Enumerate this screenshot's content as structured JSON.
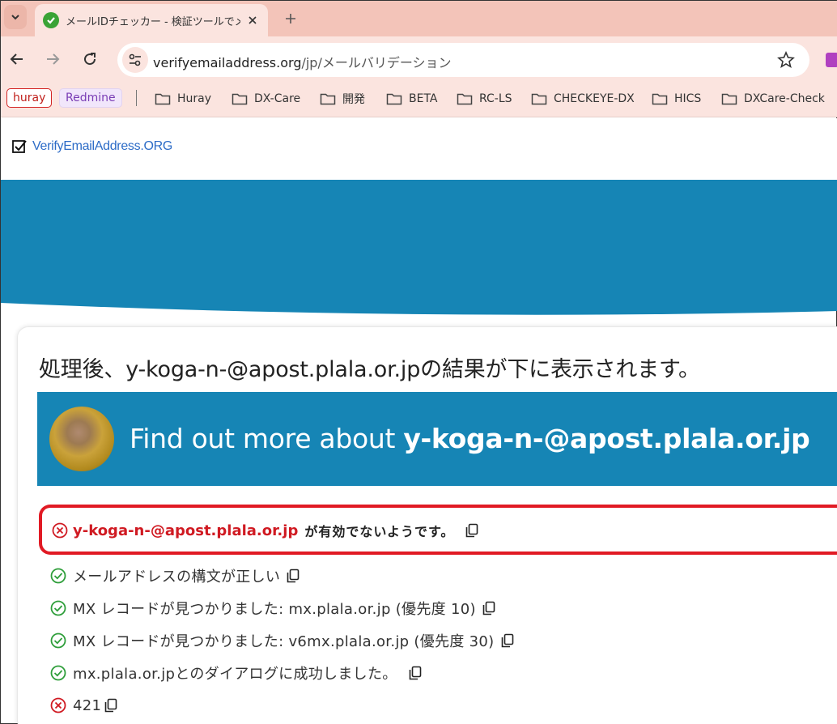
{
  "browser": {
    "tab": {
      "title": "メールIDチェッカー - 検証ツールでメール"
    },
    "address_bar": {
      "domain": "verifyemailaddress.org",
      "path": "/jp/メールバリデーション"
    },
    "bookmarks": {
      "chips": [
        {
          "label": "huray"
        },
        {
          "label": "Redmine"
        }
      ],
      "folders": [
        {
          "label": "Huray"
        },
        {
          "label": "DX-Care"
        },
        {
          "label": "開発"
        },
        {
          "label": "BETA"
        },
        {
          "label": "RC-LS"
        },
        {
          "label": "CHECKEYE-DX"
        },
        {
          "label": "HICS"
        },
        {
          "label": "DXCare-Check"
        }
      ]
    }
  },
  "site": {
    "logo_text": "VerifyEmailAddress.ORG",
    "heading": {
      "prefix": "処理後、",
      "email": "y-koga-n-@apost.plala.or.jp",
      "suffix": "の結果が下に表示されます。"
    },
    "banner": {
      "prefix": "Find out more about ",
      "email": "y-koga-n-@apost.plala.or.jp"
    },
    "result": {
      "status": "invalid",
      "email": "y-koga-n-@apost.plala.or.jp",
      "message": "が有効でないようです。"
    },
    "checks": [
      {
        "status": "ok",
        "text": "メールアドレスの構文が正しい"
      },
      {
        "status": "ok",
        "text": "MX レコードが見つかりました: mx.plala.or.jp (優先度 10)"
      },
      {
        "status": "ok",
        "text": "MX レコードが見つかりました: v6mx.plala.or.jp (優先度 30)"
      },
      {
        "status": "ok",
        "text": "mx.plala.or.jpとのダイアログに成功しました。"
      },
      {
        "status": "error",
        "text": "421"
      }
    ]
  },
  "colors": {
    "chrome_tabstrip": "#f3c4b9",
    "chrome_toolbar": "#fbe4df",
    "hero_blue": "#1685b5",
    "error_red": "#e11a24",
    "ok_green": "#2e9e3a",
    "logo_blue": "#2d6cc7"
  }
}
